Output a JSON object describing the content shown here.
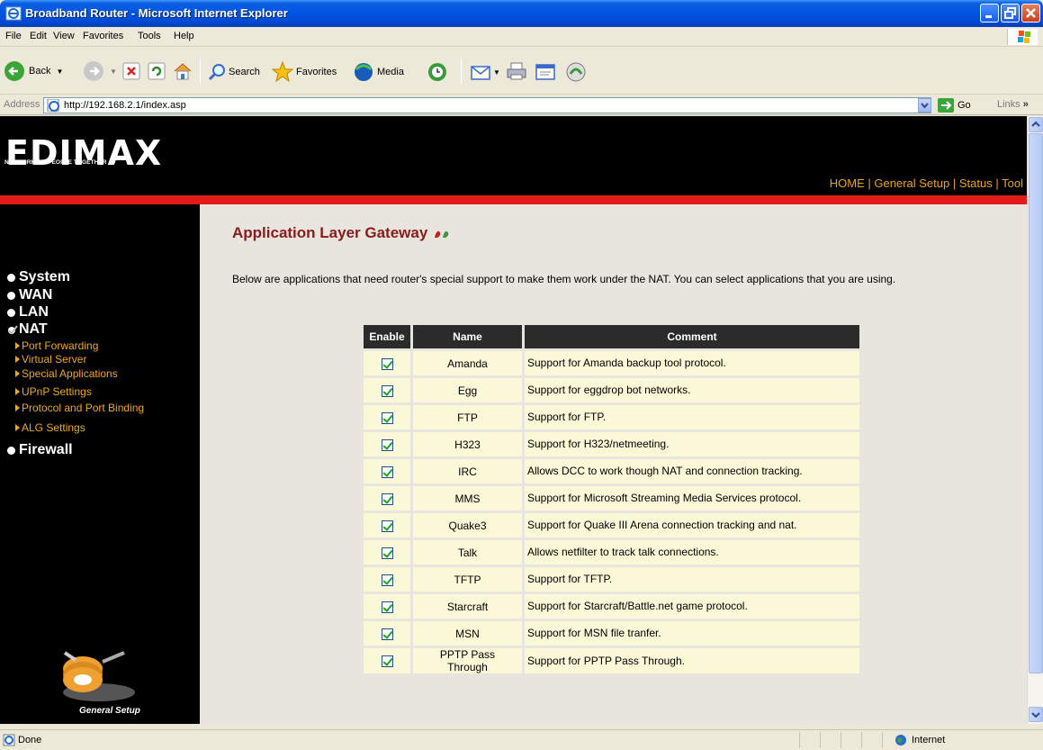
{
  "window": {
    "title": "Broadband Router - Microsoft Internet Explorer"
  },
  "menu": [
    "File",
    "Edit",
    "View",
    "Favorites",
    "Tools",
    "Help"
  ],
  "toolbar": {
    "back": "Back",
    "search": "Search",
    "favorites": "Favorites",
    "media": "Media"
  },
  "address": {
    "label": "Address",
    "url": "http://192.168.2.1/index.asp",
    "go": "Go",
    "links": "Links"
  },
  "header": {
    "brand": "EDIMAX",
    "tagline": "NETWORKING PEOPLE TOGETHER",
    "nav": [
      "HOME",
      "General Setup",
      "Status",
      "Tool"
    ],
    "nav_sep": "|"
  },
  "sidebar": {
    "items": [
      "System",
      "WAN",
      "LAN",
      "NAT",
      "Firewall"
    ],
    "nat_sub": [
      "Port Forwarding",
      "Virtual Server",
      "Special Applications",
      "UPnP Settings",
      "Protocol and Port Binding",
      "ALG Settings"
    ],
    "footer": "General Setup"
  },
  "main": {
    "title": "Application Layer Gateway",
    "description": "Below are applications that need router's special support to make them work under the NAT. You can select applications that you are using.",
    "columns": [
      "Enable",
      "Name",
      "Comment"
    ],
    "rows": [
      {
        "enabled": true,
        "name": "Amanda",
        "comment": "Support for Amanda backup tool protocol."
      },
      {
        "enabled": true,
        "name": "Egg",
        "comment": "Support for eggdrop bot networks."
      },
      {
        "enabled": true,
        "name": "FTP",
        "comment": "Support for FTP."
      },
      {
        "enabled": true,
        "name": "H323",
        "comment": "Support for H323/netmeeting."
      },
      {
        "enabled": true,
        "name": "IRC",
        "comment": "Allows DCC to work though NAT and connection tracking."
      },
      {
        "enabled": true,
        "name": "MMS",
        "comment": "Support for Microsoft Streaming Media Services protocol."
      },
      {
        "enabled": true,
        "name": "Quake3",
        "comment": "Support for Quake III Arena connection tracking and nat."
      },
      {
        "enabled": true,
        "name": "Talk",
        "comment": "Allows netfilter to track talk connections."
      },
      {
        "enabled": true,
        "name": "TFTP",
        "comment": "Support for TFTP."
      },
      {
        "enabled": true,
        "name": "Starcraft",
        "comment": "Support for Starcraft/Battle.net game protocol."
      },
      {
        "enabled": true,
        "name": "MSN",
        "comment": "Support for MSN file tranfer."
      },
      {
        "enabled": true,
        "name": "PPTP Pass Through",
        "comment": "Support for PPTP Pass Through."
      }
    ]
  },
  "status": {
    "left": "Done",
    "zone": "Internet"
  }
}
